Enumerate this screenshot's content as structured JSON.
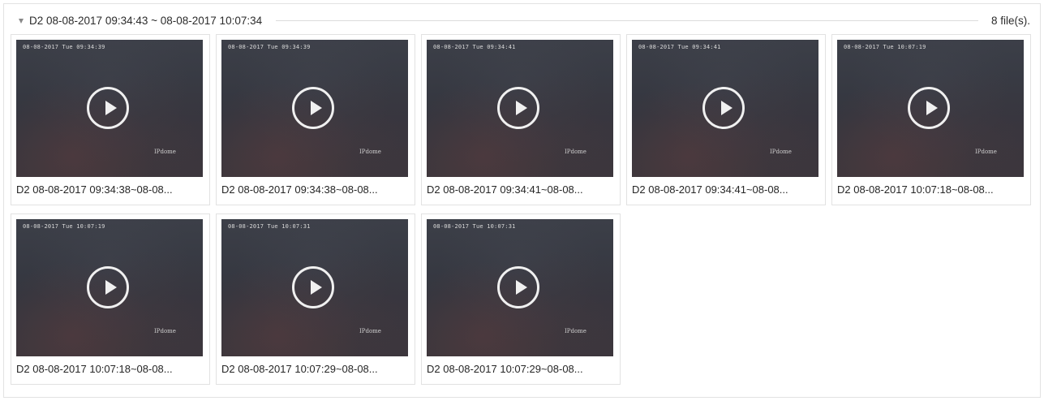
{
  "group": {
    "title": "D2 08-08-2017 09:34:43 ~ 08-08-2017 10:07:34",
    "count": "8 file(s).",
    "toggle_icon": "caret-down-icon"
  },
  "play_icon": "play-circle-icon",
  "files": [
    {
      "overlay_time": "08-08-2017 Tue 09:34:39",
      "overlay_name": "IPdome",
      "caption": "D2 08-08-2017 09:34:38~08-08..."
    },
    {
      "overlay_time": "08-08-2017 Tue 09:34:39",
      "overlay_name": "IPdome",
      "caption": "D2 08-08-2017 09:34:38~08-08..."
    },
    {
      "overlay_time": "08-08-2017 Tue 09:34:41",
      "overlay_name": "IPdome",
      "caption": "D2 08-08-2017 09:34:41~08-08..."
    },
    {
      "overlay_time": "08-08-2017 Tue 09:34:41",
      "overlay_name": "IPdome",
      "caption": "D2 08-08-2017 09:34:41~08-08..."
    },
    {
      "overlay_time": "08-08-2017 Tue 10:07:19",
      "overlay_name": "IPdome",
      "caption": "D2 08-08-2017 10:07:18~08-08..."
    },
    {
      "overlay_time": "08-08-2017 Tue 10:07:19",
      "overlay_name": "IPdome",
      "caption": "D2 08-08-2017 10:07:18~08-08..."
    },
    {
      "overlay_time": "08-08-2017 Tue 10:07:31",
      "overlay_name": "IPdome",
      "caption": "D2 08-08-2017 10:07:29~08-08..."
    },
    {
      "overlay_time": "08-08-2017 Tue 10:07:31",
      "overlay_name": "IPdome",
      "caption": "D2 08-08-2017 10:07:29~08-08..."
    }
  ]
}
